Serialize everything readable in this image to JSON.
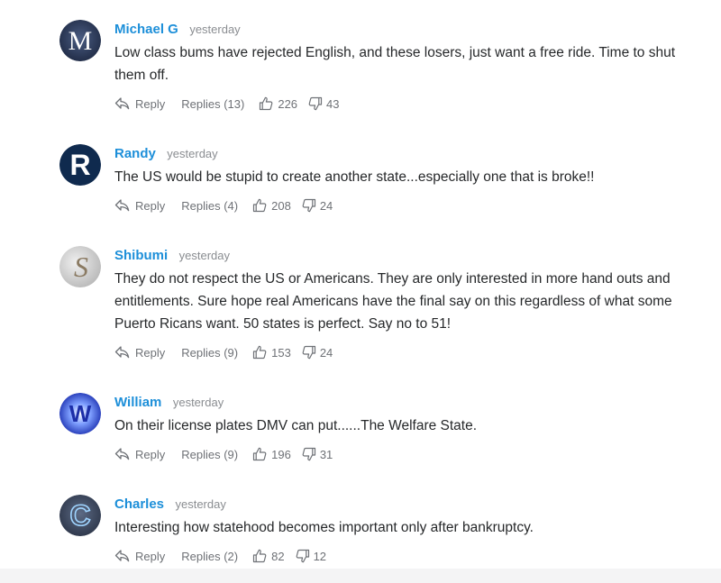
{
  "actions": {
    "reply_label": "Reply"
  },
  "comments": [
    {
      "author": "Michael G",
      "time": "yesterday",
      "avatar_letter": "M",
      "avatar_color": "#2f3d5c",
      "text": "Low class bums have rejected English, and these losers, just want a free ride. Time to shut them off.",
      "replies": "Replies (13)",
      "likes": "226",
      "dislikes": "43"
    },
    {
      "author": "Randy",
      "time": "yesterday",
      "avatar_letter": "R",
      "avatar_color": "#0f2a4e",
      "text": "The US would be stupid to create another state...especially one that is broke!!",
      "replies": "Replies (4)",
      "likes": "208",
      "dislikes": "24"
    },
    {
      "author": "Shibumi",
      "time": "yesterday",
      "avatar_letter": "S",
      "avatar_color": "#cfcfcf",
      "text": "They do not respect the US or Americans. They are only interested in more hand outs and entitlements. Sure hope real Americans have the final say on this regardless of what some Puerto Ricans want. 50 states is perfect. Say no to 51!",
      "replies": "Replies (9)",
      "likes": "153",
      "dislikes": "24"
    },
    {
      "author": "William",
      "time": "yesterday",
      "avatar_letter": "W",
      "avatar_color": "#1b2fb0",
      "text": "On their license plates DMV can put......The Welfare State.",
      "replies": "Replies (9)",
      "likes": "196",
      "dislikes": "31"
    },
    {
      "author": "Charles",
      "time": "yesterday",
      "avatar_letter": "C",
      "avatar_color": "#3d4a60",
      "text": "Interesting how statehood becomes important only after bankruptcy.",
      "replies": "Replies (2)",
      "likes": "82",
      "dislikes": "12"
    }
  ],
  "icons": {
    "reply": "reply-arrow-icon",
    "like": "thumbs-up-icon",
    "dislike": "thumbs-down-icon"
  },
  "colors": {
    "author_link": "#1d8fd9",
    "meta_gray": "#8a8d91",
    "text": "#26282a"
  }
}
